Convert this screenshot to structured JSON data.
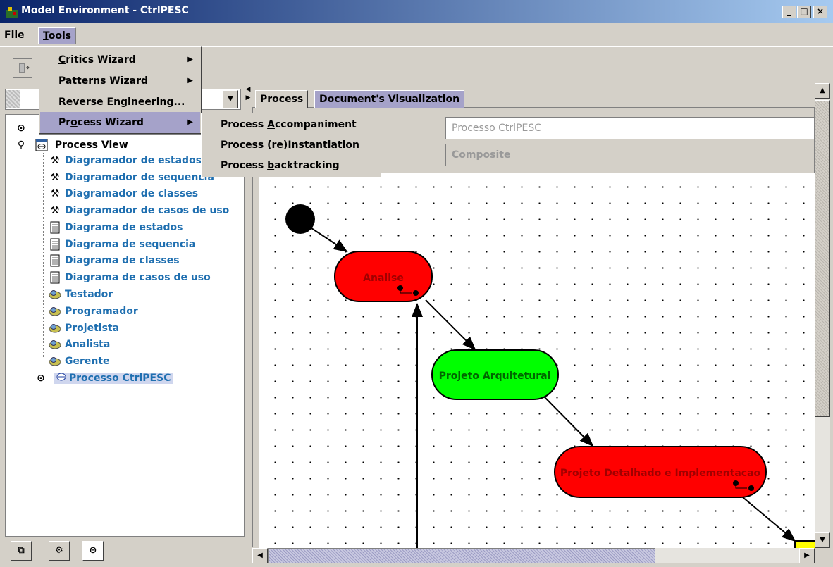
{
  "window": {
    "title": "Model Environment - CtrlPESC",
    "minimize": "_",
    "maximize": "□",
    "close": "×"
  },
  "menubar": {
    "file_first": "F",
    "file_rest": "ile",
    "tools_first": "T",
    "tools_rest": "ools"
  },
  "tools_menu": {
    "critics_first": "C",
    "critics_rest": "ritics Wizard",
    "patterns_first": "P",
    "patterns_rest": "atterns Wizard",
    "reverse_first": "R",
    "reverse_rest": "everse Engineering...",
    "process_pre": "Pr",
    "process_u": "o",
    "process_rest": "cess Wizard"
  },
  "process_submenu": {
    "accomp_pre": "Process ",
    "accomp_u": "A",
    "accomp_rest": "ccompaniment",
    "inst_pre": "Process (re)",
    "inst_u": "I",
    "inst_rest": "nstantiation",
    "back_pre": "Process ",
    "back_u": "b",
    "back_rest": "acktracking"
  },
  "tree": {
    "process_view": "Process View",
    "items": [
      "Diagramador de estados",
      "Diagramador de sequencia",
      "Diagramador de classes",
      "Diagramador de casos de uso",
      "Diagrama de estados",
      "Diagrama de sequencia",
      "Diagrama de classes",
      "Diagrama de casos de uso",
      "Testador",
      "Programador",
      "Projetista",
      "Analista",
      "Gerente"
    ],
    "process_node": "Processo CtrlPESC"
  },
  "tabs": {
    "process": "Process",
    "docvis": "Document's Visualization"
  },
  "fields": {
    "name_value": "Processo CtrlPESC",
    "type_value": "Composite"
  },
  "diagram": {
    "nodes": [
      {
        "label": "Analise",
        "color": "#ff0000"
      },
      {
        "label": "Projeto Arquitetural",
        "color": "#00ff00"
      },
      {
        "label": "Projeto Detalhado e Implementacao",
        "color": "#ff0000"
      }
    ]
  },
  "colors": {
    "selection": "#a5a2c9",
    "tree_link": "#1f6fb0"
  }
}
